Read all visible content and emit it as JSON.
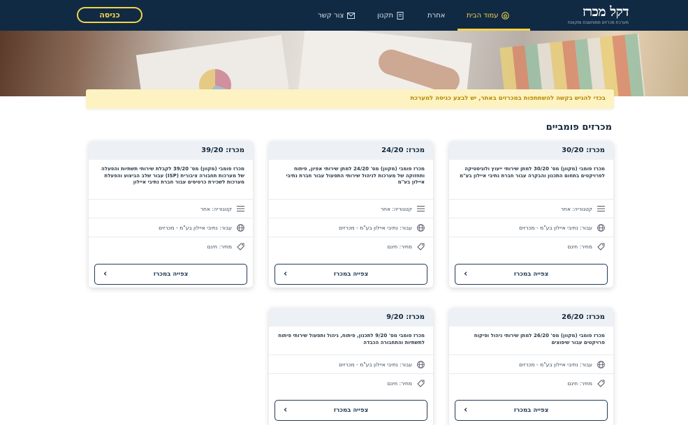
{
  "header": {
    "login_label": "כניסה",
    "nav": {
      "contact": "צור קשר",
      "regulations": "תקנון",
      "other": "אחרת",
      "home": "עמוד הבית"
    },
    "logo": {
      "main": "דקל מכרז",
      "sub": "מערכת מכרזים ממוחשבת ומקוונת"
    }
  },
  "banner": {
    "text": "בכדי להגיש בקשה להשתתפות במכרזים באתר, יש לבצע כניסה למערכת"
  },
  "section": {
    "title": "מכרזים פומביים"
  },
  "cards": [
    {
      "title": "מכרז: 30/20",
      "desc": "מכרז פומבי (מקוון) מס' 30/20 למתן שירותי ייעוץ ולוגיסטיקה לפרויקטים בתחום התכנון והבקרה עבור חברת נתיבי איילון בע\"מ",
      "category": "קטגוריה: אחר",
      "for": "עבור: נתיבי איילון בע\"מ - מכרזים",
      "price": "מחיר: חינם",
      "button": "צפייה במכרז"
    },
    {
      "title": "מכרז: 24/20",
      "desc": "מכרז פומבי (מקוון) מס' 24/20 למתן שירותי אפיון, פיתוח ותחזוקה של מערכות לניהול שירותי התפעול עבור חברת נתיבי איילון בע\"מ",
      "category": "קטגוריה: אחר",
      "for": "עבור: נתיבי איילון בע\"מ - מכרזים",
      "price": "מחיר: חינם",
      "button": "צפייה במכרז"
    },
    {
      "title": "מכרז: 39/20",
      "desc": "מכרז פומבי (מקוון) מס' 39/20 לקבלת שירותי תשתיות והפעלה של מערכות תחבורה ציבורית (ISP) עבור שלב הביצוע והפעלת מערכות לשכירת כרטיסים עבור חברת נתיבי איילון",
      "category": "קטגוריה: אחר",
      "for": "עבור: נתיבי איילון בע\"מ - מכרזים",
      "price": "מחיר: חינם",
      "button": "צפייה במכרז"
    },
    {
      "title": "מכרז: 26/20",
      "desc": "מכרז פומבי (מקוון) מס' 26/20 למתן שירותי ניהול ופיקוח פרויקטים עבור שיפוצים",
      "for": "עבור: נתיבי איילון בע\"מ - מכרזים",
      "price": "מחיר: חינם",
      "button": "צפייה במכרז"
    },
    {
      "title": "מכרז: 9/20",
      "desc": "מכרז פומבי מס' 9/20 לתכנון, פיתוח, ניהול ותפעול שירותי פיתוח לתשתיות והתחבורה הכבדה",
      "for": "עבור: נתיבי איילון בע\"מ - מכרזים",
      "price": "מחיר: חינם",
      "button": "צפייה במכרז"
    }
  ]
}
